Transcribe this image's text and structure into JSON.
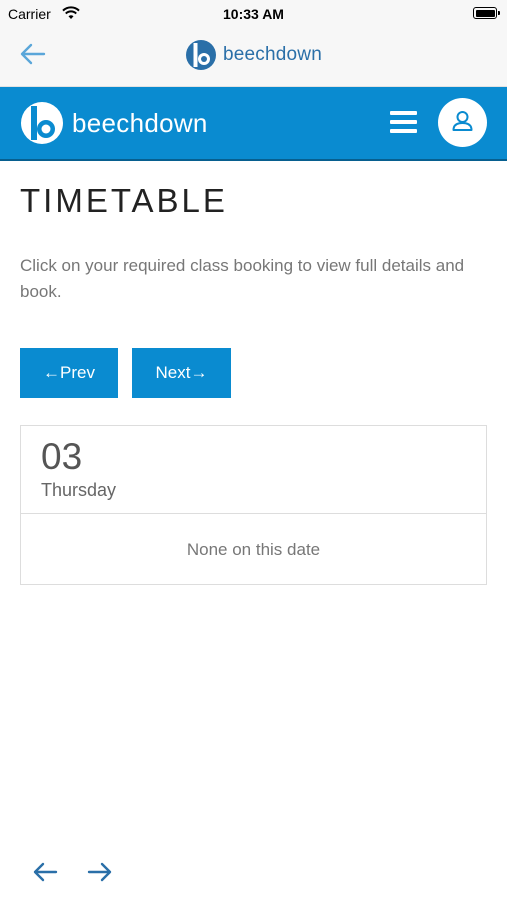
{
  "status_bar": {
    "carrier": "Carrier",
    "time": "10:33 AM"
  },
  "app_bar": {
    "brand": "beechdown"
  },
  "site_header": {
    "brand": "beechdown"
  },
  "page": {
    "title": "TIMETABLE",
    "intro": "Click on your required class booking to view full details and book."
  },
  "pager": {
    "prev_label": "←Prev",
    "next_label": "Next→"
  },
  "day": {
    "number": "03",
    "name": "Thursday",
    "empty_message": "None on this date"
  },
  "colors": {
    "brand_blue": "#0a8bd0",
    "nav_blue": "#2a6fa8"
  }
}
